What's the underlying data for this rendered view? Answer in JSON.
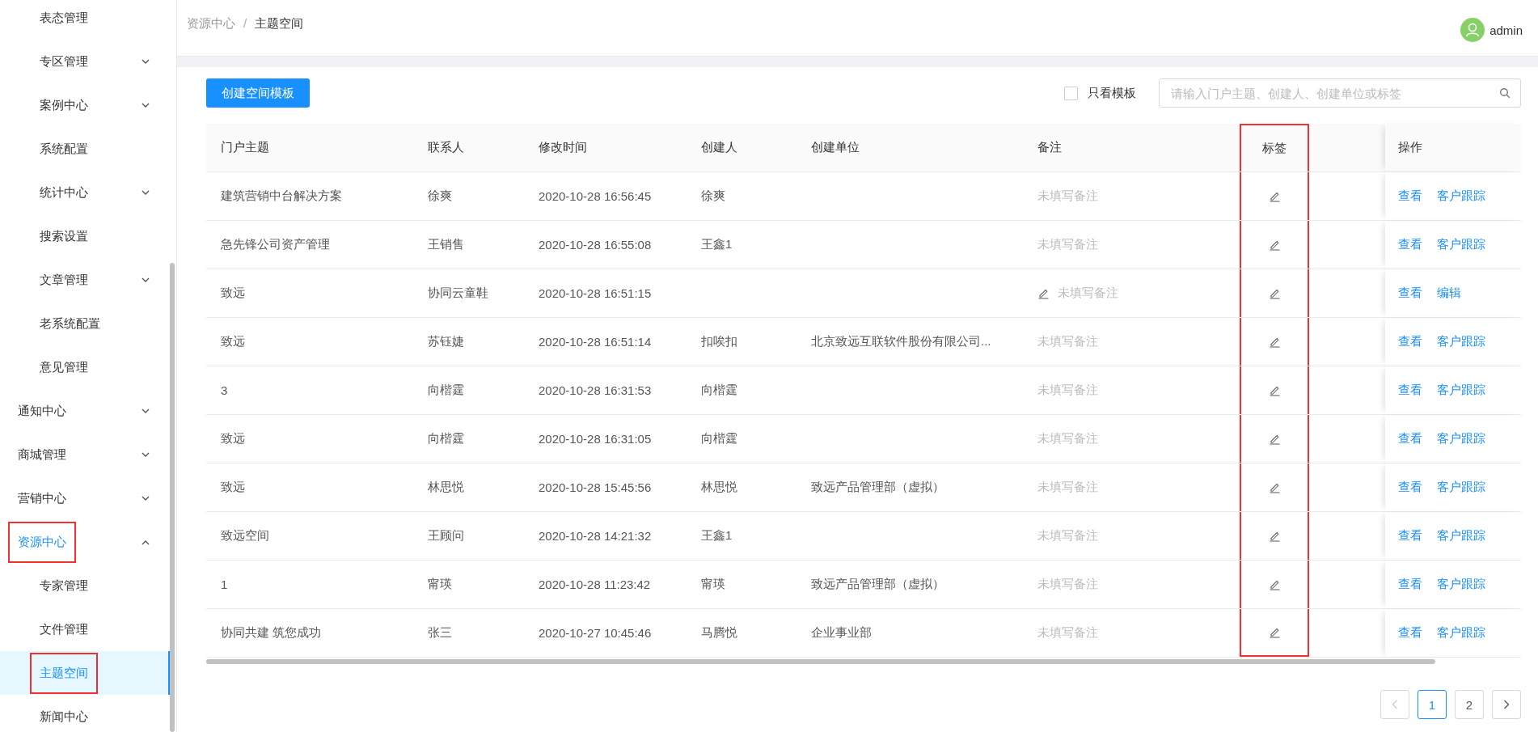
{
  "sidebar": {
    "items": [
      {
        "children": [
          {
            "label": "表态管理",
            "selected": false,
            "annotated": false
          },
          {
            "label": "专区管理",
            "expanded": false,
            "selected": false,
            "annotated": false
          },
          {
            "label": "案例中心",
            "expanded": false,
            "selected": false,
            "annotated": false
          },
          {
            "label": "系统配置",
            "selected": false,
            "annotated": false
          },
          {
            "label": "统计中心",
            "expanded": false,
            "selected": false,
            "annotated": false
          },
          {
            "label": "搜索设置",
            "selected": false,
            "annotated": false
          },
          {
            "label": "文章管理",
            "expanded": false,
            "selected": false,
            "annotated": false
          },
          {
            "label": "老系统配置",
            "selected": false,
            "annotated": false
          },
          {
            "label": "意见管理",
            "selected": false,
            "annotated": false
          }
        ]
      },
      {
        "label": "通知中心",
        "expanded": false,
        "selected": false,
        "annotated": false
      },
      {
        "label": "商城管理",
        "expanded": false,
        "selected": false,
        "annotated": false
      },
      {
        "label": "营销中心",
        "expanded": false,
        "selected": false,
        "annotated": false
      },
      {
        "label": "资源中心",
        "expanded": true,
        "selected": false,
        "annotated": true,
        "children": [
          {
            "label": "专家管理",
            "selected": false,
            "annotated": false
          },
          {
            "label": "文件管理",
            "selected": false,
            "annotated": false
          },
          {
            "label": "主题空间",
            "selected": true,
            "annotated": true
          },
          {
            "label": "新闻中心",
            "selected": false,
            "annotated": false
          }
        ]
      }
    ]
  },
  "breadcrumb": [
    "资源中心",
    "主题空间"
  ],
  "breadcrumb_separator": "/",
  "user": {
    "name": "admin"
  },
  "toolbar": {
    "create_button": "创建空间模板",
    "template_only": {
      "label": "只看模板",
      "checked": false
    },
    "search": {
      "placeholder": "请输入门户主题、创建人、创建单位或标签"
    }
  },
  "table": {
    "columns": [
      {
        "label": "门户主题",
        "annotated": false
      },
      {
        "label": "联系人",
        "annotated": false
      },
      {
        "label": "修改时间",
        "annotated": false
      },
      {
        "label": "创建人",
        "annotated": false
      },
      {
        "label": "创建单位",
        "annotated": false
      },
      {
        "label": "备注",
        "annotated": false
      },
      {
        "label": "标签",
        "annotated": true
      },
      {
        "label": "操作",
        "annotated": false
      }
    ],
    "rows": [
      {
        "topic": "建筑营销中台解决方案",
        "contact": "徐爽",
        "modified": "2020-10-28 16:56:45",
        "creator": "徐爽",
        "org": "",
        "remark": {
          "kind": "plain",
          "text": "未填写备注"
        },
        "actions": [
          "查看",
          "客户跟踪"
        ]
      },
      {
        "topic": "急先锋公司资产管理",
        "contact": "王销售",
        "modified": "2020-10-28 16:55:08",
        "creator": "王鑫1",
        "org": "",
        "remark": {
          "kind": "plain",
          "text": "未填写备注"
        },
        "actions": [
          "查看",
          "客户跟踪"
        ]
      },
      {
        "topic": "致远",
        "contact": "协同云童鞋",
        "modified": "2020-10-28 16:51:15",
        "creator": "",
        "org": "",
        "remark": {
          "kind": "editable",
          "text": "未填写备注"
        },
        "actions": [
          "查看",
          "编辑"
        ]
      },
      {
        "topic": "致远",
        "contact": "苏钰婕",
        "modified": "2020-10-28 16:51:14",
        "creator": "扣唉扣",
        "org": "北京致远互联软件股份有限公司...",
        "remark": {
          "kind": "plain",
          "text": "未填写备注"
        },
        "actions": [
          "查看",
          "客户跟踪"
        ]
      },
      {
        "topic": "3",
        "contact": "向楷霆",
        "modified": "2020-10-28 16:31:53",
        "creator": "向楷霆",
        "org": "",
        "remark": {
          "kind": "plain",
          "text": "未填写备注"
        },
        "actions": [
          "查看",
          "客户跟踪"
        ]
      },
      {
        "topic": "致远",
        "contact": "向楷霆",
        "modified": "2020-10-28 16:31:05",
        "creator": "向楷霆",
        "org": "",
        "remark": {
          "kind": "plain",
          "text": "未填写备注"
        },
        "actions": [
          "查看",
          "客户跟踪"
        ]
      },
      {
        "topic": "致远",
        "contact": "林思悦",
        "modified": "2020-10-28 15:45:56",
        "creator": "林思悦",
        "org": "致远产品管理部（虚拟）",
        "remark": {
          "kind": "plain",
          "text": "未填写备注"
        },
        "actions": [
          "查看",
          "客户跟踪"
        ]
      },
      {
        "topic": "致远空间",
        "contact": "王顾问",
        "modified": "2020-10-28 14:21:32",
        "creator": "王鑫1",
        "org": "",
        "remark": {
          "kind": "plain",
          "text": "未填写备注"
        },
        "actions": [
          "查看",
          "客户跟踪"
        ]
      },
      {
        "topic": "1",
        "contact": "甯瑛",
        "modified": "2020-10-28 11:23:42",
        "creator": "甯瑛",
        "org": "致远产品管理部（虚拟）",
        "remark": {
          "kind": "plain",
          "text": "未填写备注"
        },
        "actions": [
          "查看",
          "客户跟踪"
        ]
      },
      {
        "topic": "协同共建 筑您成功",
        "contact": "张三",
        "modified": "2020-10-27 10:45:46",
        "creator": "马腾悦",
        "org": "企业事业部",
        "remark": {
          "kind": "plain",
          "text": "未填写备注"
        },
        "actions": [
          "查看",
          "客户跟踪"
        ]
      }
    ]
  },
  "pagination": {
    "prev_disabled": true,
    "next_disabled": false,
    "pages": [
      {
        "label": "1",
        "selected": true
      },
      {
        "label": "2",
        "selected": false
      }
    ]
  }
}
